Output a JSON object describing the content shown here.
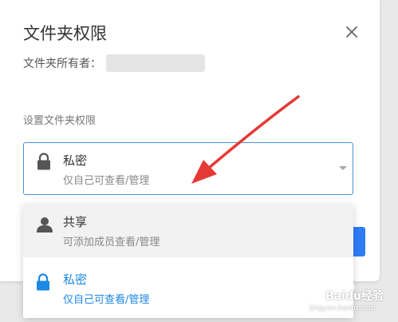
{
  "dialog": {
    "title": "文件夹权限",
    "owner_label": "文件夹所有者：",
    "perm_label": "设置文件夹权限"
  },
  "select": {
    "title": "私密",
    "desc": "仅自己可查看/管理"
  },
  "options": [
    {
      "title": "共享",
      "desc": "可添加成员查看/管理"
    },
    {
      "title": "私密",
      "desc": "仅自己可查看/管理"
    }
  ],
  "watermark": {
    "text": "Baidu经验",
    "url": "jingyan.baidu.com"
  },
  "colors": {
    "accent": "#1e88e5",
    "arrow": "#e53935",
    "border_focus": "#4a90d9"
  },
  "icons": {
    "close": "close-icon",
    "lock": "lock-icon",
    "caret": "caret-down-icon",
    "user": "user-icon"
  }
}
